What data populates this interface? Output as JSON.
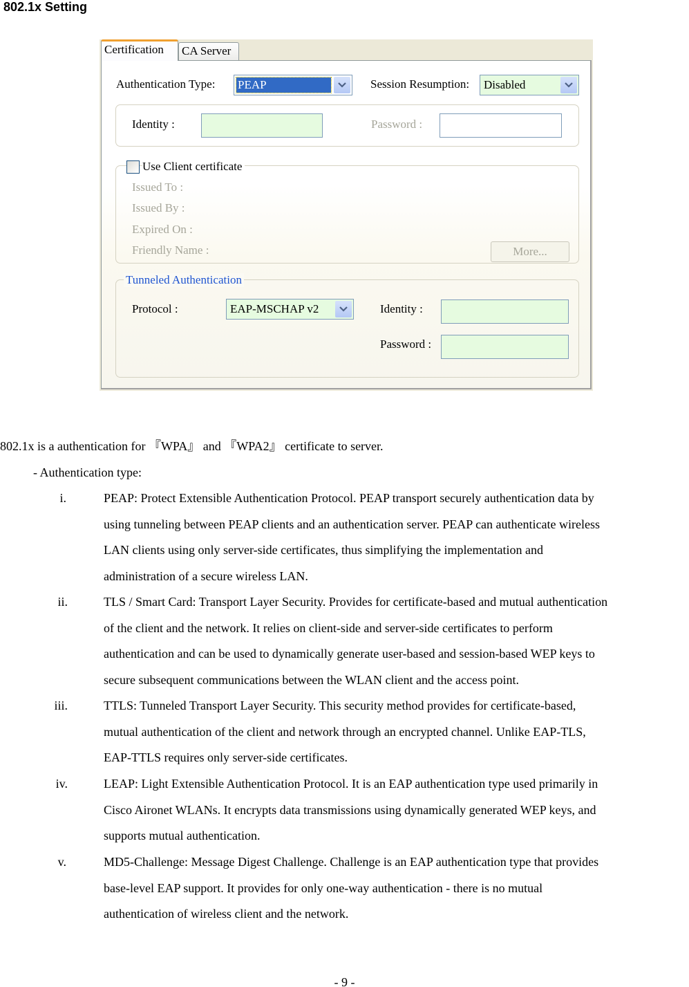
{
  "heading": "802.1x Setting",
  "dialog": {
    "tabs": [
      {
        "label": "Certification",
        "active": true
      },
      {
        "label": "CA Server",
        "active": false
      }
    ],
    "auth_type": {
      "label": "Authentication Type:",
      "value": "PEAP"
    },
    "session_resumption": {
      "label": "Session Resumption:",
      "value": "Disabled"
    },
    "identity": {
      "label": "Identity :",
      "value": ""
    },
    "password": {
      "label": "Password :",
      "value": ""
    },
    "client_cert": {
      "checkbox_label": "Use Client certificate",
      "checked": false,
      "fields": [
        "Issued To :",
        "Issued By :",
        "Expired On :",
        "Friendly Name :"
      ],
      "more_button": "More..."
    },
    "tunneled": {
      "legend": "Tunneled Authentication",
      "protocol_label": "Protocol :",
      "protocol_value": "EAP-MSCHAP v2",
      "identity_label": "Identity :",
      "identity_value": "",
      "password_label": "Password :",
      "password_value": ""
    },
    "colors": {
      "selected_highlight": "#316ac5",
      "active_field_bg": "#e6fbe0",
      "tab_accent": "#f0a030",
      "group_legend_blue": "#1f55d0"
    }
  },
  "intro": "802.1x is a authentication for 『WPA』 and 『WPA2』 certificate to server.",
  "subheading": "- Authentication type:",
  "auth_types": [
    {
      "marker": "i.",
      "lines": [
        "PEAP: Protect Extensible Authentication Protocol. PEAP transport securely authentication data by",
        "using tunneling between PEAP clients and an authentication server. PEAP can authenticate wireless",
        "LAN clients using only server-side certificates, thus simplifying the implementation and",
        "administration of a secure wireless LAN."
      ]
    },
    {
      "marker": "ii.",
      "lines": [
        "TLS / Smart Card: Transport Layer Security. Provides for certificate-based and mutual authentication",
        "of the client and the network. It relies on client-side and server-side certificates to perform",
        "authentication and can be used to dynamically generate user-based and session-based WEP keys to",
        "secure subsequent communications between the WLAN client and the access point."
      ]
    },
    {
      "marker": "iii.",
      "lines": [
        "TTLS: Tunneled Transport Layer Security. This security method provides for certificate-based,",
        "mutual authentication of the client and network through an encrypted channel. Unlike EAP-TLS,",
        "EAP-TTLS requires only server-side certificates."
      ]
    },
    {
      "marker": "iv.",
      "lines": [
        "LEAP: Light Extensible Authentication Protocol. It is an EAP authentication type used primarily in",
        "Cisco Aironet WLANs. It encrypts data transmissions using dynamically generated WEP keys, and",
        "supports mutual authentication."
      ]
    },
    {
      "marker": "v.",
      "lines": [
        "MD5-Challenge: Message Digest Challenge. Challenge is an EAP authentication type that provides",
        "base-level EAP support. It provides for only one-way authentication - there is no mutual",
        "authentication of wireless client and the network."
      ]
    }
  ],
  "page_number": "- 9 -"
}
